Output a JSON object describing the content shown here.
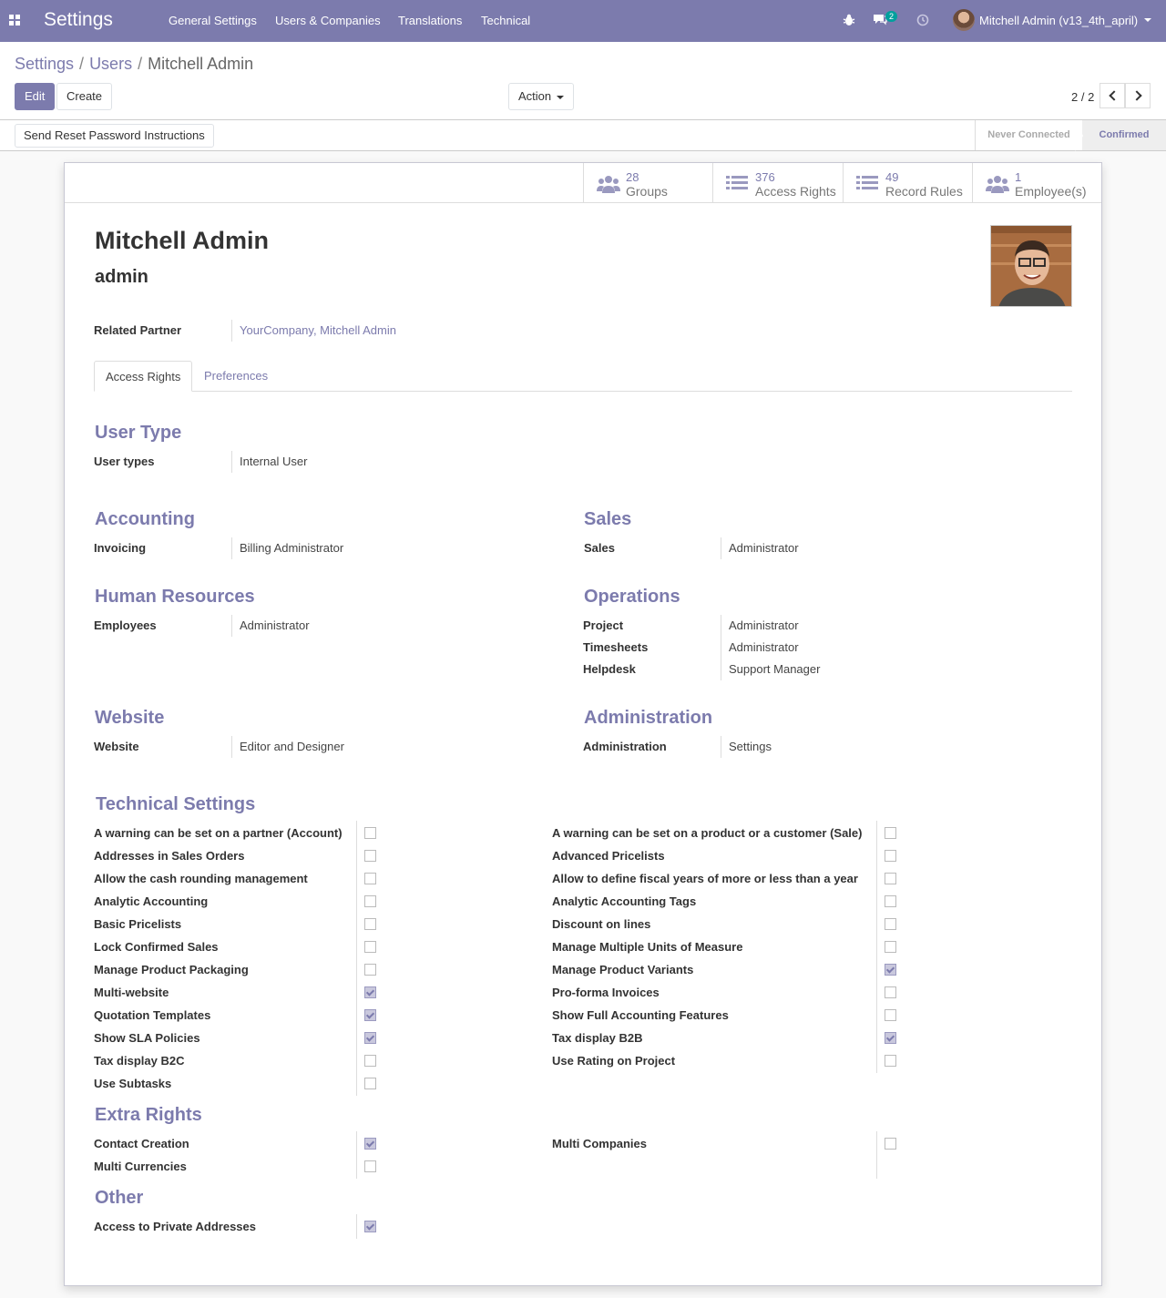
{
  "navbar": {
    "app_title": "Settings",
    "menu": [
      "General Settings",
      "Users & Companies",
      "Translations",
      "Technical"
    ],
    "messages_badge": "2",
    "user": "Mitchell Admin (v13_4th_april)",
    "icons": [
      "apps-icon",
      "bug-icon",
      "chat-icon",
      "clock-icon"
    ]
  },
  "breadcrumb": {
    "root": "Settings",
    "parent": "Users",
    "current": "Mitchell Admin",
    "sep": "/"
  },
  "toolbar": {
    "edit": "Edit",
    "create": "Create",
    "action": "Action",
    "pager": "2 / 2"
  },
  "statusbar": {
    "reset_button": "Send Reset Password Instructions",
    "stages": [
      "Never Connected",
      "Confirmed"
    ],
    "active_stage": "Confirmed"
  },
  "stats": [
    {
      "value": "28",
      "label": "Groups",
      "icon": "users-icon"
    },
    {
      "value": "376",
      "label": "Access Rights",
      "icon": "list-icon"
    },
    {
      "value": "49",
      "label": "Record Rules",
      "icon": "list-icon"
    },
    {
      "value": "1",
      "label": "Employee(s)",
      "icon": "users-icon"
    }
  ],
  "user": {
    "name": "Mitchell Admin",
    "login": "admin",
    "related_partner_label": "Related Partner",
    "related_partner": "YourCompany, Mitchell Admin"
  },
  "tabs": {
    "access": "Access Rights",
    "preferences": "Preferences"
  },
  "user_type": {
    "title": "User Type",
    "label": "User types",
    "value": "Internal User"
  },
  "groups": {
    "accounting": {
      "title": "Accounting",
      "label": "Invoicing",
      "value": "Billing Administrator"
    },
    "sales": {
      "title": "Sales",
      "label": "Sales",
      "value": "Administrator"
    },
    "hr": {
      "title": "Human Resources",
      "label": "Employees",
      "value": "Administrator"
    },
    "operations": {
      "title": "Operations",
      "rows": [
        {
          "label": "Project",
          "value": "Administrator"
        },
        {
          "label": "Timesheets",
          "value": "Administrator"
        },
        {
          "label": "Helpdesk",
          "value": "Support Manager"
        }
      ]
    },
    "website": {
      "title": "Website",
      "label": "Website",
      "value": "Editor and Designer"
    },
    "administration": {
      "title": "Administration",
      "label": "Administration",
      "value": "Settings"
    }
  },
  "technical": {
    "title": "Technical Settings",
    "left": [
      {
        "label": "A warning can be set on a partner (Account)",
        "checked": false
      },
      {
        "label": "Addresses in Sales Orders",
        "checked": false
      },
      {
        "label": "Allow the cash rounding management",
        "checked": false
      },
      {
        "label": "Analytic Accounting",
        "checked": false
      },
      {
        "label": "Basic Pricelists",
        "checked": false
      },
      {
        "label": "Lock Confirmed Sales",
        "checked": false
      },
      {
        "label": "Manage Product Packaging",
        "checked": false
      },
      {
        "label": "Multi-website",
        "checked": true
      },
      {
        "label": "Quotation Templates",
        "checked": true
      },
      {
        "label": "Show SLA Policies",
        "checked": true
      },
      {
        "label": "Tax display B2C",
        "checked": false
      },
      {
        "label": "Use Subtasks",
        "checked": false
      }
    ],
    "right": [
      {
        "label": "A warning can be set on a product or a customer (Sale)",
        "checked": false
      },
      {
        "label": "Advanced Pricelists",
        "checked": false
      },
      {
        "label": "Allow to define fiscal years of more or less than a year",
        "checked": false
      },
      {
        "label": "Analytic Accounting Tags",
        "checked": false
      },
      {
        "label": "Discount on lines",
        "checked": false
      },
      {
        "label": "Manage Multiple Units of Measure",
        "checked": false
      },
      {
        "label": "Manage Product Variants",
        "checked": true
      },
      {
        "label": "Pro-forma Invoices",
        "checked": false
      },
      {
        "label": "Show Full Accounting Features",
        "checked": false
      },
      {
        "label": "Tax display B2B",
        "checked": true
      },
      {
        "label": "Use Rating on Project",
        "checked": false
      }
    ]
  },
  "extra_rights": {
    "title": "Extra Rights",
    "left": [
      {
        "label": "Contact Creation",
        "checked": true
      },
      {
        "label": "Multi Currencies",
        "checked": false
      }
    ],
    "right": [
      {
        "label": "Multi Companies",
        "checked": false
      }
    ]
  },
  "other": {
    "title": "Other",
    "left": [
      {
        "label": "Access to Private Addresses",
        "checked": true
      }
    ]
  }
}
